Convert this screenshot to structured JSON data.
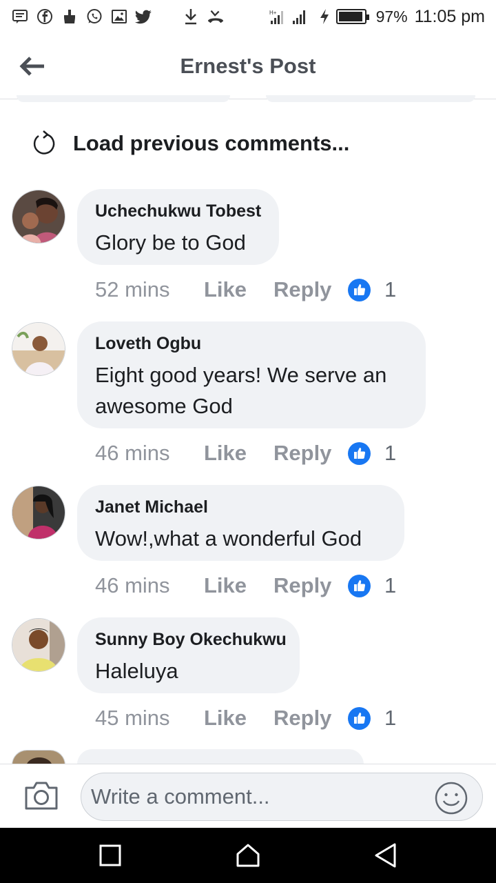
{
  "status_bar": {
    "battery": "97%",
    "time": "11:05 pm",
    "icons": [
      "message-icon",
      "facebook-icon",
      "cleaner-icon",
      "whatsapp-icon",
      "gallery-icon",
      "twitter-icon",
      "download-icon",
      "missed-call-icon",
      "signal-icon",
      "charging-icon",
      "battery-icon"
    ]
  },
  "header": {
    "title": "Ernest's Post",
    "back_icon": "arrow-left-icon"
  },
  "load_previous": {
    "label": "Load previous comments...",
    "icon": "refresh-icon"
  },
  "comments": [
    {
      "author": "Uchechukwu Tobest",
      "text": "Glory be to God",
      "time": "52 mins",
      "like": "Like",
      "reply": "Reply",
      "reactions": "1"
    },
    {
      "author": "Loveth Ogbu",
      "text": "Eight good years! We serve an awesome God",
      "time": "46 mins",
      "like": "Like",
      "reply": "Reply",
      "reactions": "1"
    },
    {
      "author": "Janet Michael",
      "text": "Wow!,what a wonderful God",
      "time": "46 mins",
      "like": "Like",
      "reply": "Reply",
      "reactions": "1"
    },
    {
      "author": "Sunny Boy Okechukwu",
      "text": "Haleluya",
      "time": "45 mins",
      "like": "Like",
      "reply": "Reply",
      "reactions": "1"
    }
  ],
  "composer": {
    "placeholder": "Write a comment...",
    "camera_icon": "camera-icon",
    "emoji_icon": "emoji-icon"
  },
  "nav": {
    "recents": "square-icon",
    "home": "home-icon",
    "back": "triangle-back-icon"
  },
  "colors": {
    "accent": "#1877f2",
    "bubble": "#f0f2f5",
    "meta": "#90949c"
  }
}
